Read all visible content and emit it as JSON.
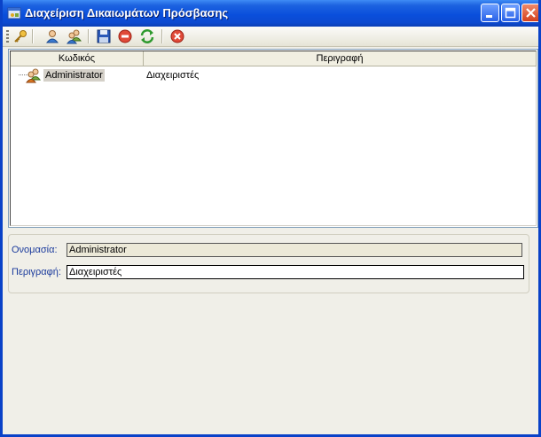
{
  "window": {
    "title": "Διαχείριση Δικαιωμάτων Πρόσβασης",
    "controls": [
      "minimize-icon",
      "maximize-icon",
      "close-icon"
    ],
    "title_bar_color": "#0a4fdc"
  },
  "toolbar": {
    "buttons": [
      {
        "name": "key-icon",
        "color": "#e0a820"
      },
      {
        "name": "user-icon",
        "color": "#3a7ad0"
      },
      {
        "name": "users-icon",
        "color": "#3a7ad0"
      },
      {
        "name": "save-icon",
        "color": "#2a58b8"
      },
      {
        "name": "delete-icon",
        "color": "#d83a2a"
      },
      {
        "name": "refresh-icon",
        "color": "#2f9a2f"
      },
      {
        "name": "close-icon",
        "color": "#d83a2a"
      }
    ]
  },
  "grid": {
    "columns": [
      "Κωδικός",
      "Περιγραφή"
    ],
    "rows": [
      {
        "code": "Administrator",
        "description": "Διαχειριστές",
        "icon": "users-icon",
        "selected": true
      }
    ]
  },
  "details": {
    "name_label": "Ονομασία:",
    "name_value": "Administrator",
    "description_label": "Περιγραφή:",
    "description_value": "Διαχειριστές"
  }
}
